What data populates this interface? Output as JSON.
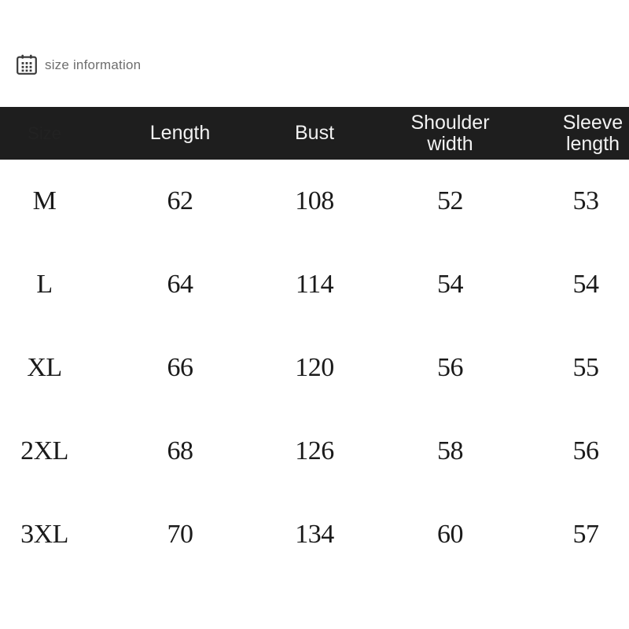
{
  "caption": {
    "icon": "calendar-icon",
    "label": "size information"
  },
  "theme": {
    "page_background": "#ffffff",
    "header_background": "#1e1e1e",
    "header_text": "#f2f2f2",
    "body_text": "#1a1a1a",
    "caption_text": "#6e6e6e"
  },
  "table": {
    "headers": [
      {
        "key": "size",
        "label": "Size"
      },
      {
        "key": "length",
        "label": "Length"
      },
      {
        "key": "bust",
        "label": "Bust"
      },
      {
        "key": "shoulder_width",
        "label": "Shoulder\nwidth"
      },
      {
        "key": "sleeve_length",
        "label": "Sleeve\nlength"
      }
    ],
    "rows": [
      {
        "size": "M",
        "length": "62",
        "bust": "108",
        "shoulder_width": "52",
        "sleeve_length": "53"
      },
      {
        "size": "L",
        "length": "64",
        "bust": "114",
        "shoulder_width": "54",
        "sleeve_length": "54"
      },
      {
        "size": "XL",
        "length": "66",
        "bust": "120",
        "shoulder_width": "56",
        "sleeve_length": "55"
      },
      {
        "size": "2XL",
        "length": "68",
        "bust": "126",
        "shoulder_width": "58",
        "sleeve_length": "56"
      },
      {
        "size": "3XL",
        "length": "70",
        "bust": "134",
        "shoulder_width": "60",
        "sleeve_length": "57"
      }
    ]
  }
}
